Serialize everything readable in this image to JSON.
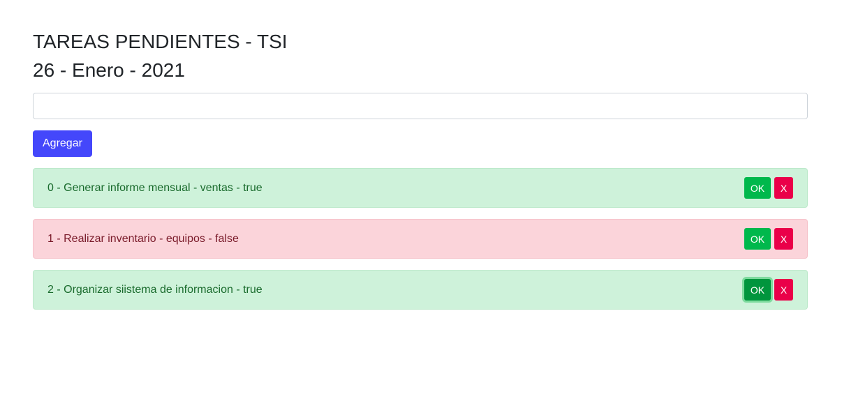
{
  "header": {
    "title": "TAREAS PENDIENTES - TSI",
    "date": "26 - Enero - 2021"
  },
  "form": {
    "input_value": "",
    "add_label": "Agregar"
  },
  "tasks": [
    {
      "text": "0 - Generar informe mensual - ventas - true",
      "status": "done",
      "ok_label": "OK",
      "delete_label": "X"
    },
    {
      "text": "1 - Realizar inventario - equipos - false",
      "status": "pending",
      "ok_label": "OK",
      "delete_label": "X"
    },
    {
      "text": "2 - Organizar siistema de informacion - true",
      "status": "done",
      "ok_label": "OK",
      "delete_label": "X"
    }
  ],
  "colors": {
    "add_button": "#4447fb",
    "ok_button": "#00b84c",
    "delete_button": "#ea0049",
    "done_background": "#cef2da",
    "pending_background": "#fbd4da"
  }
}
